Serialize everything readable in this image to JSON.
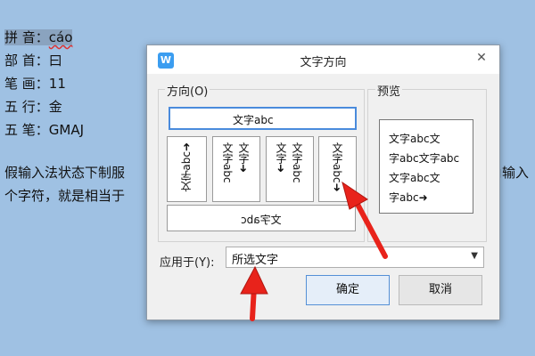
{
  "document": {
    "lines": [
      {
        "label": "拼 音：",
        "value": "cáo"
      },
      {
        "label": "部 首：",
        "value": "曰"
      },
      {
        "label": "笔 画：",
        "value": "11"
      },
      {
        "label": "五 行：",
        "value": "金"
      },
      {
        "label": "五 笔：",
        "value": "GMAJ"
      }
    ],
    "para_line1_left": "假输入法状态下制服",
    "para_line1_right": "角输入",
    "para_line2_left": "个字符，就是相当于"
  },
  "dialog": {
    "app_icon": "W",
    "title": "文字方向",
    "close_icon": "✕",
    "direction_group_label": "方向(O)",
    "preview_group_label": "预览",
    "options": {
      "horizontal": "文字abc",
      "opt2": "文字abc➜",
      "opt3_col1": "文字abc",
      "opt3_col2": "文字➜",
      "opt4_col1": "文字➜",
      "opt4_col2": "文字abc",
      "opt5": "文字abc➜",
      "bottom": "文字abc"
    },
    "preview_lines": [
      "文字abc文",
      "字abc文字abc",
      "文字abc文",
      "字abc➜"
    ],
    "apply_label": "应用于(Y):",
    "apply_value": "所选文字",
    "ok_label": "确定",
    "cancel_label": "取消"
  },
  "colors": {
    "background": "#9fc1e3",
    "accent": "#4a8bdc",
    "arrow": "#e8231b"
  }
}
